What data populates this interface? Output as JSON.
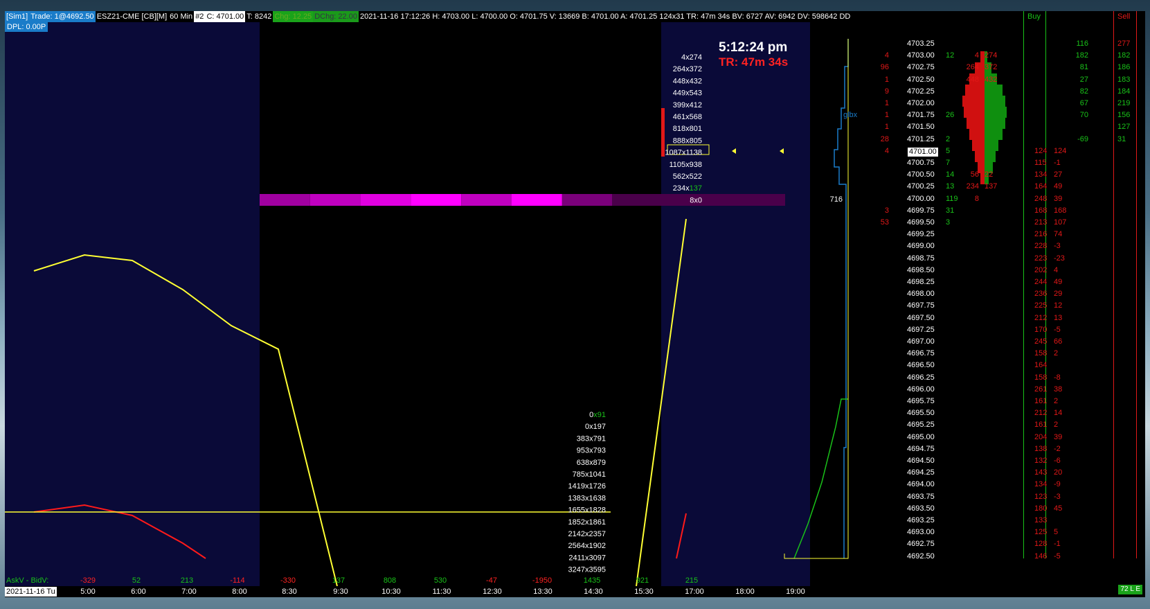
{
  "header": {
    "account": "[Sim1]",
    "trade": "Trade: 1@4692.50",
    "symbol": "ESZ21-CME [CB][M]",
    "interval": "60 Min",
    "num": "#2",
    "close": "C: 4701.00",
    "ticks": "T: 8242",
    "chg": "Chg: 12.25",
    "dchg": "DChg: 22.00",
    "stats": "2021-11-16 17:12:26 H: 4703.00 L: 4700.00 O: 4701.75 V: 13669 B: 4701.00 A: 4701.25 124x31 TR: 47m 34s BV: 6727 AV: 6942 DV: 598642 DD"
  },
  "dpl": "DPL: 0.00P",
  "clock": {
    "time": "5:12:24 pm",
    "tr": "TR: 47m 34s"
  },
  "glbx": "glbx",
  "heat_value": "716",
  "upper_pairs": [
    "4x274",
    "264x372",
    "448x432",
    "449x543",
    "399x412",
    "461x568",
    "818x801",
    "888x805",
    "1087x1138",
    "1105x938",
    "562x522",
    "234x137",
    "8x0"
  ],
  "lower_pairs": [
    "0x91",
    "0x197",
    "383x791",
    "953x793",
    "638x879",
    "785x1041",
    "1419x1726",
    "1383x1638",
    "1655x1828",
    "1852x1861",
    "2142x2357",
    "2564x1902",
    "2411x3097",
    "3247x3595"
  ],
  "askbid": {
    "label": "AskV - BidV:",
    "values": [
      {
        "v": "-329",
        "c": "red"
      },
      {
        "v": "52",
        "c": "green"
      },
      {
        "v": "213",
        "c": "green"
      },
      {
        "v": "-114",
        "c": "red"
      },
      {
        "v": "-330",
        "c": "red"
      },
      {
        "v": "137",
        "c": "green"
      },
      {
        "v": "808",
        "c": "green"
      },
      {
        "v": "530",
        "c": "green"
      },
      {
        "v": "-47",
        "c": "red"
      },
      {
        "v": "-1950",
        "c": "red"
      },
      {
        "v": "1435",
        "c": "green"
      },
      {
        "v": "921",
        "c": "green"
      },
      {
        "v": "215",
        "c": "green"
      }
    ]
  },
  "time_axis": {
    "date": "2021-11-16 Tu",
    "labels": [
      "5:00",
      "6:00",
      "7:00",
      "8:00",
      "8:30",
      "9:30",
      "10:30",
      "11:30",
      "12:30",
      "13:30",
      "14:30",
      "15:30",
      "17:00",
      "18:00",
      "19:00"
    ]
  },
  "ladder": {
    "buy_header": "Buy",
    "sell_header": "Sell",
    "rows": [
      {
        "p": "4703.25",
        "a": "",
        "b": "",
        "bid": "",
        "ask": "",
        "bv": "",
        "sv": "116",
        "svc": "green",
        "tot": "277",
        "totc": "red"
      },
      {
        "p": "4703.00",
        "a": "4",
        "b": "12",
        "bid": "4",
        "ask": "274",
        "bv": "",
        "sv": "182",
        "svc": "green",
        "tot": "182",
        "totc": "green"
      },
      {
        "p": "4702.75",
        "a": "96",
        "b": "",
        "bid": "264",
        "ask": "372",
        "bv": "",
        "sv": "81",
        "svc": "green",
        "tot": "186",
        "totc": "green"
      },
      {
        "p": "4702.50",
        "a": "1",
        "b": "",
        "bid": "448",
        "ask": "432",
        "bv": "",
        "sv": "27",
        "svc": "green",
        "tot": "183",
        "totc": "green"
      },
      {
        "p": "4702.25",
        "a": "9",
        "b": "",
        "bid": "",
        "ask": "",
        "bv": "",
        "sv": "82",
        "svc": "green",
        "tot": "184",
        "totc": "green"
      },
      {
        "p": "4702.00",
        "a": "1",
        "b": "",
        "bid": "",
        "ask": "",
        "bv": "",
        "sv": "67",
        "svc": "green",
        "tot": "219",
        "totc": "green"
      },
      {
        "p": "4701.75",
        "a": "1",
        "b": "26",
        "bid": "",
        "ask": "",
        "bv": "",
        "sv": "70",
        "svc": "green",
        "tot": "156",
        "totc": "green"
      },
      {
        "p": "4701.50",
        "a": "1",
        "b": "",
        "bid": "",
        "ask": "",
        "bv": "",
        "sv": "",
        "svc": "green",
        "tot": "127",
        "totc": "green"
      },
      {
        "p": "4701.25",
        "a": "28",
        "b": "2",
        "bid": "",
        "ask": "",
        "bv": "",
        "sv": "-69",
        "svc": "green",
        "tot": "31",
        "totc": "green"
      },
      {
        "p": "4701.00",
        "a": "4",
        "b": "5",
        "bid": "",
        "ask": "",
        "bv": "124",
        "bvc": "red",
        "sv": "",
        "tot": "124",
        "totc": "red",
        "cur": true
      },
      {
        "p": "4700.75",
        "a": "",
        "b": "7",
        "bid": "",
        "ask": "",
        "bv": "115",
        "bvc": "red",
        "sv": "",
        "tot": "-1",
        "totc": "red"
      },
      {
        "p": "4700.50",
        "a": "",
        "b": "14",
        "bid": "56",
        "ask": "22",
        "bv": "134",
        "bvc": "red",
        "sv": "",
        "tot": "27",
        "totc": "red"
      },
      {
        "p": "4700.25",
        "a": "",
        "b": "13",
        "bid": "234",
        "ask": "137",
        "bv": "164",
        "bvc": "red",
        "sv": "",
        "tot": "49",
        "totc": "red"
      },
      {
        "p": "4700.00",
        "a": "",
        "b": "119",
        "bid": "8",
        "ask": "",
        "bv": "248",
        "bvc": "red",
        "sv": "",
        "tot": "39",
        "totc": "red"
      },
      {
        "p": "4699.75",
        "a": "3",
        "b": "31",
        "bid": "",
        "ask": "",
        "bv": "168",
        "bvc": "red",
        "sv": "",
        "tot": "168",
        "totc": "red"
      },
      {
        "p": "4699.50",
        "a": "53",
        "b": "3",
        "bid": "",
        "ask": "",
        "bv": "213",
        "bvc": "red",
        "sv": "",
        "tot": "107",
        "totc": "red"
      },
      {
        "p": "4699.25",
        "a": "",
        "b": "",
        "bid": "",
        "ask": "",
        "bv": "216",
        "bvc": "red",
        "sv": "",
        "tot": "74",
        "totc": "red"
      },
      {
        "p": "4699.00",
        "a": "",
        "b": "",
        "bid": "",
        "ask": "",
        "bv": "228",
        "bvc": "red",
        "sv": "",
        "tot": "-3",
        "totc": "red"
      },
      {
        "p": "4698.75",
        "a": "",
        "b": "",
        "bid": "",
        "ask": "",
        "bv": "223",
        "bvc": "red",
        "sv": "",
        "tot": "-23",
        "totc": "red"
      },
      {
        "p": "4698.50",
        "a": "",
        "b": "",
        "bid": "",
        "ask": "",
        "bv": "202",
        "bvc": "red",
        "sv": "",
        "tot": "4",
        "totc": "red"
      },
      {
        "p": "4698.25",
        "a": "",
        "b": "",
        "bid": "",
        "ask": "",
        "bv": "244",
        "bvc": "red",
        "sv": "",
        "tot": "49",
        "totc": "red"
      },
      {
        "p": "4698.00",
        "a": "",
        "b": "",
        "bid": "",
        "ask": "",
        "bv": "236",
        "bvc": "red",
        "sv": "",
        "tot": "29",
        "totc": "red"
      },
      {
        "p": "4697.75",
        "a": "",
        "b": "",
        "bid": "",
        "ask": "",
        "bv": "225",
        "bvc": "red",
        "sv": "",
        "tot": "12",
        "totc": "red"
      },
      {
        "p": "4697.50",
        "a": "",
        "b": "",
        "bid": "",
        "ask": "",
        "bv": "212",
        "bvc": "red",
        "sv": "",
        "tot": "13",
        "totc": "red"
      },
      {
        "p": "4697.25",
        "a": "",
        "b": "",
        "bid": "",
        "ask": "",
        "bv": "170",
        "bvc": "red",
        "sv": "",
        "tot": "-5",
        "totc": "red"
      },
      {
        "p": "4697.00",
        "a": "",
        "b": "",
        "bid": "",
        "ask": "",
        "bv": "245",
        "bvc": "red",
        "sv": "",
        "tot": "66",
        "totc": "red"
      },
      {
        "p": "4696.75",
        "a": "",
        "b": "",
        "bid": "",
        "ask": "",
        "bv": "158",
        "bvc": "red",
        "sv": "",
        "tot": "2",
        "totc": "red"
      },
      {
        "p": "4696.50",
        "a": "",
        "b": "",
        "bid": "",
        "ask": "",
        "bv": "164",
        "bvc": "red",
        "sv": "",
        "tot": "",
        "totc": "red"
      },
      {
        "p": "4696.25",
        "a": "",
        "b": "",
        "bid": "",
        "ask": "",
        "bv": "158",
        "bvc": "red",
        "sv": "",
        "tot": "-8",
        "totc": "red"
      },
      {
        "p": "4696.00",
        "a": "",
        "b": "",
        "bid": "",
        "ask": "",
        "bv": "261",
        "bvc": "red",
        "sv": "",
        "tot": "38",
        "totc": "red"
      },
      {
        "p": "4695.75",
        "a": "",
        "b": "",
        "bid": "",
        "ask": "",
        "bv": "161",
        "bvc": "red",
        "sv": "",
        "tot": "2",
        "totc": "red"
      },
      {
        "p": "4695.50",
        "a": "",
        "b": "",
        "bid": "",
        "ask": "",
        "bv": "212",
        "bvc": "red",
        "sv": "",
        "tot": "14",
        "totc": "red"
      },
      {
        "p": "4695.25",
        "a": "",
        "b": "",
        "bid": "",
        "ask": "",
        "bv": "161",
        "bvc": "red",
        "sv": "",
        "tot": "2",
        "totc": "red"
      },
      {
        "p": "4695.00",
        "a": "",
        "b": "",
        "bid": "",
        "ask": "",
        "bv": "204",
        "bvc": "red",
        "sv": "",
        "tot": "39",
        "totc": "red"
      },
      {
        "p": "4694.75",
        "a": "",
        "b": "",
        "bid": "",
        "ask": "",
        "bv": "138",
        "bvc": "red",
        "sv": "",
        "tot": "-2",
        "totc": "red"
      },
      {
        "p": "4694.50",
        "a": "",
        "b": "",
        "bid": "",
        "ask": "",
        "bv": "132",
        "bvc": "red",
        "sv": "",
        "tot": "-6",
        "totc": "red"
      },
      {
        "p": "4694.25",
        "a": "",
        "b": "",
        "bid": "",
        "ask": "",
        "bv": "143",
        "bvc": "red",
        "sv": "",
        "tot": "20",
        "totc": "red"
      },
      {
        "p": "4694.00",
        "a": "",
        "b": "",
        "bid": "",
        "ask": "",
        "bv": "134",
        "bvc": "red",
        "sv": "",
        "tot": "-9",
        "totc": "red"
      },
      {
        "p": "4693.75",
        "a": "",
        "b": "",
        "bid": "",
        "ask": "",
        "bv": "123",
        "bvc": "red",
        "sv": "",
        "tot": "-3",
        "totc": "red"
      },
      {
        "p": "4693.50",
        "a": "",
        "b": "",
        "bid": "",
        "ask": "",
        "bv": "180",
        "bvc": "red",
        "sv": "",
        "tot": "45",
        "totc": "red"
      },
      {
        "p": "4693.25",
        "a": "",
        "b": "",
        "bid": "",
        "ask": "",
        "bv": "133",
        "bvc": "red",
        "sv": "",
        "tot": "",
        "totc": "red"
      },
      {
        "p": "4693.00",
        "a": "",
        "b": "",
        "bid": "",
        "ask": "",
        "bv": "125",
        "bvc": "red",
        "sv": "",
        "tot": "5",
        "totc": "red"
      },
      {
        "p": "4692.75",
        "a": "",
        "b": "",
        "bid": "",
        "ask": "",
        "bv": "128",
        "bvc": "red",
        "sv": "",
        "tot": "-1",
        "totc": "red"
      },
      {
        "p": "4692.50",
        "a": "",
        "b": "",
        "bid": "",
        "ask": "",
        "bv": "146",
        "bvc": "red",
        "sv": "",
        "tot": "-5",
        "totc": "red"
      }
    ]
  },
  "badge": "72 L E",
  "colors": {
    "navy": "#0a0a38",
    "magenta": "#ff00ff",
    "yellow": "#ffff33",
    "red": "#ff1a1a",
    "green": "#19c219",
    "blue": "#1a7cc9"
  }
}
